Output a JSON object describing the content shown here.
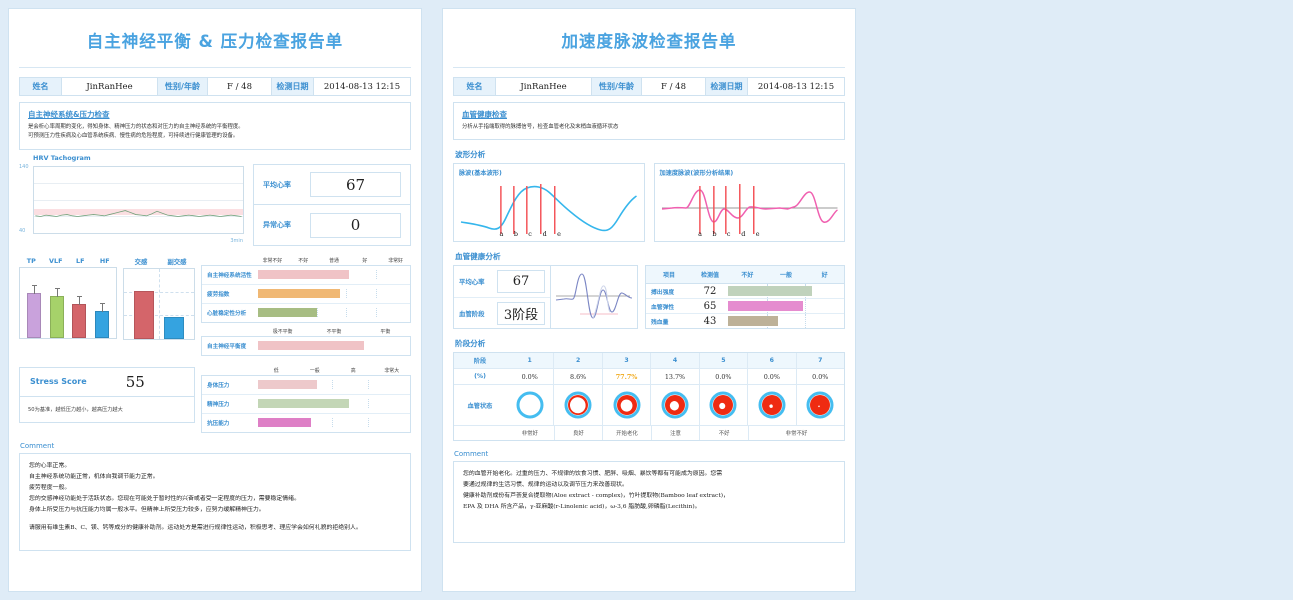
{
  "theme": {
    "page_bg": "#dfecf7",
    "accent": "#3b8fd0",
    "title_color": "#4aa3e0",
    "border": "#cfe2f0"
  },
  "patient": {
    "name_label": "姓名",
    "name_value": "JinRanHee",
    "sex_label": "性别/年龄",
    "sex_value": "F / 48",
    "date_label": "检测日期",
    "date_value": "2014-08-13 12:15"
  },
  "left_page": {
    "title": "自主神经平衡 & 压力检查报告单",
    "intro": {
      "heading": "自主神经系统&压力检查",
      "line1": "是会析心率周期的变化，得知身体、精神压力的状态和对压力的自主神经系统的平衡程度。",
      "line2": "可预测压力性疾病及心血管系统疾病、慢性病的危险程度，可持续进行健康管理的设备。"
    },
    "hrv": {
      "chart_label": "HRV Tachogram",
      "y_max": "140",
      "y_min": "40",
      "x_label": "3min",
      "avg_hr_label": "平均心率",
      "avg_hr_value": "67",
      "abnormal_hr_label": "异常心率",
      "abnormal_hr_value": "0"
    },
    "meters_activity": {
      "scale": [
        "非常不好",
        "不好",
        "普通",
        "好",
        "非常好"
      ],
      "rows": [
        {
          "label": "自主神经系统活性",
          "pct": 62,
          "color": "#f0c3c6"
        },
        {
          "label": "疲劳指数",
          "pct": 56,
          "color": "#f0b874"
        },
        {
          "label": "心脏稳定性分析",
          "pct": 40,
          "color": "#a7bd83"
        }
      ]
    },
    "meters_balance": {
      "scale": [
        "极不平衡",
        "不平衡",
        "平衡"
      ],
      "rows": [
        {
          "label": "自主神经平衡度",
          "pct": 72,
          "color": "#f0c3c6"
        }
      ]
    },
    "stress": {
      "label": "Stress Score",
      "value": "55",
      "note": "50为基准，越低压力越小，越高压力越大"
    },
    "meters_stress": {
      "scale": [
        "低",
        "一般",
        "高",
        "非常大"
      ],
      "rows": [
        {
          "label": "身体压力",
          "pct": 40,
          "color": "#edc9cb"
        },
        {
          "label": "精神压力",
          "pct": 62,
          "color": "#c3d6b6"
        },
        {
          "label": "抗压能力",
          "pct": 36,
          "color": "#de7fc6"
        }
      ]
    },
    "comment": {
      "heading": "Comment",
      "body": "您的心率正常。\n自主神经系统功能正常，机体自我调节能力正常。\n疲劳程度一般。\n您的交感神经功能处于活跃状态。您现在可能处于暂时性的兴奋或者受一定程度的压力，需要稳定情绪。\n身体上所受压力与抗压能力均属一般水平。但精神上所受压力较多，应努力缓解精神压力。",
      "body2": "请服用有维生素B、C、镁、钙等成分的健康补助剂。运动处方是需进行规律性运动，积极思考、理应学会如何礼貌的拒绝别人。"
    }
  },
  "right_page": {
    "title": "加速度脉波检查报告单",
    "intro": {
      "heading": "血管健康检查",
      "line1": "分析从手指端取得的脉搏信号，检查血管老化及末梢血液循环状态"
    },
    "wave_section_title": "波形分析",
    "wave_cards": [
      {
        "title": "脉波(基本波形)",
        "marks": [
          "a",
          "b",
          "c",
          "d",
          "e"
        ]
      },
      {
        "title": "加速度脉波(波形分析结果)",
        "marks": [
          "a",
          "b",
          "c",
          "d",
          "e"
        ]
      }
    ],
    "vascular_section_title": "血管健康分析",
    "vascular": {
      "avg_hr_label": "平均心率",
      "avg_hr_value": "67",
      "stage_label": "血管阶段",
      "stage_value": "3阶段"
    },
    "vtable": {
      "headers": [
        "项目",
        "检测值",
        "不好",
        "一般",
        "好"
      ],
      "rows": [
        {
          "name": "搏出强度",
          "value": "72",
          "pct": 72,
          "color": "#c0d2bc"
        },
        {
          "name": "血管弹性",
          "value": "65",
          "pct": 65,
          "color": "#e58ccf"
        },
        {
          "name": "残血量",
          "value": "43",
          "pct": 43,
          "color": "#bdb198"
        }
      ]
    },
    "stage_section_title": "阶段分析",
    "stage_table": {
      "row_label_stage": "阶段",
      "row_label_pct": "(%)",
      "row_label_vessel": "血管状态",
      "stages": [
        "1",
        "2",
        "3",
        "4",
        "5",
        "6",
        "7"
      ],
      "percents": [
        "0.0%",
        "8.6%",
        "77.7%",
        "13.7%",
        "0.0%",
        "0.0%",
        "0.0%"
      ],
      "highlight_index": 2,
      "highlight_color": "#f0a818",
      "vessel_fill": [
        0,
        18,
        38,
        52,
        68,
        82,
        92
      ],
      "footer": [
        {
          "label": "非常好",
          "span": 1
        },
        {
          "label": "良好",
          "span": 1
        },
        {
          "label": "开始老化",
          "span": 1
        },
        {
          "label": "注意",
          "span": 1
        },
        {
          "label": "不好",
          "span": 1
        },
        {
          "label": "非常不好",
          "span": 2
        }
      ]
    },
    "comment": {
      "heading": "Comment",
      "body": "您的血管开始老化。过重的压力、不规律的饮食习惯、肥胖、吸烟、暴饮等都有可能成为原因。您需\n要通过规律的生活习惯、规律的运动以及调节压力来改善现状。\n健康补助剂成份有芦荟复合提取物(Aloe extract - complex)，竹叶提取物(Bamboo leaf extract)，\nEPA 及 DHA 所含产品，γ-亚麻酸(r-Linolenic acid)，ω-3,6 脂肪酸,卵磷脂(Lecithin)。"
    }
  },
  "chart_data": [
    {
      "type": "line",
      "title": "HRV Tachogram",
      "xlabel": "3min",
      "ylabel": "",
      "ylim": [
        40,
        140
      ],
      "series": [
        {
          "name": "HR",
          "values": [
            66,
            65,
            67,
            66,
            65,
            67,
            68,
            66,
            65,
            66,
            67,
            68,
            67,
            66,
            68,
            70,
            72,
            74,
            71,
            68,
            67,
            66,
            69,
            73,
            70,
            67,
            66,
            65,
            66,
            67,
            66,
            65,
            66,
            67,
            66,
            65,
            66,
            67,
            66,
            65
          ]
        }
      ]
    },
    {
      "type": "bar",
      "title": "Frequency domain",
      "categories": [
        "TP",
        "VLF",
        "LF",
        "HF"
      ],
      "values": [
        72,
        68,
        54,
        44
      ],
      "ylim": [
        0,
        100
      ],
      "colors": [
        "#c9a2dc",
        "#a6d26a",
        "#d4656a",
        "#35a3e0"
      ]
    },
    {
      "type": "bar",
      "title": "自主神经",
      "categories": [
        "交感",
        "副交感"
      ],
      "values": [
        78,
        36
      ],
      "ylim": [
        0,
        100
      ],
      "colors": [
        "#d4656a",
        "#35a3e0"
      ]
    },
    {
      "type": "bar",
      "title": "阶段分析",
      "categories": [
        "1",
        "2",
        "3",
        "4",
        "5",
        "6",
        "7"
      ],
      "values": [
        0.0,
        8.6,
        77.7,
        13.7,
        0.0,
        0.0,
        0.0
      ],
      "ylabel": "(%)"
    }
  ]
}
